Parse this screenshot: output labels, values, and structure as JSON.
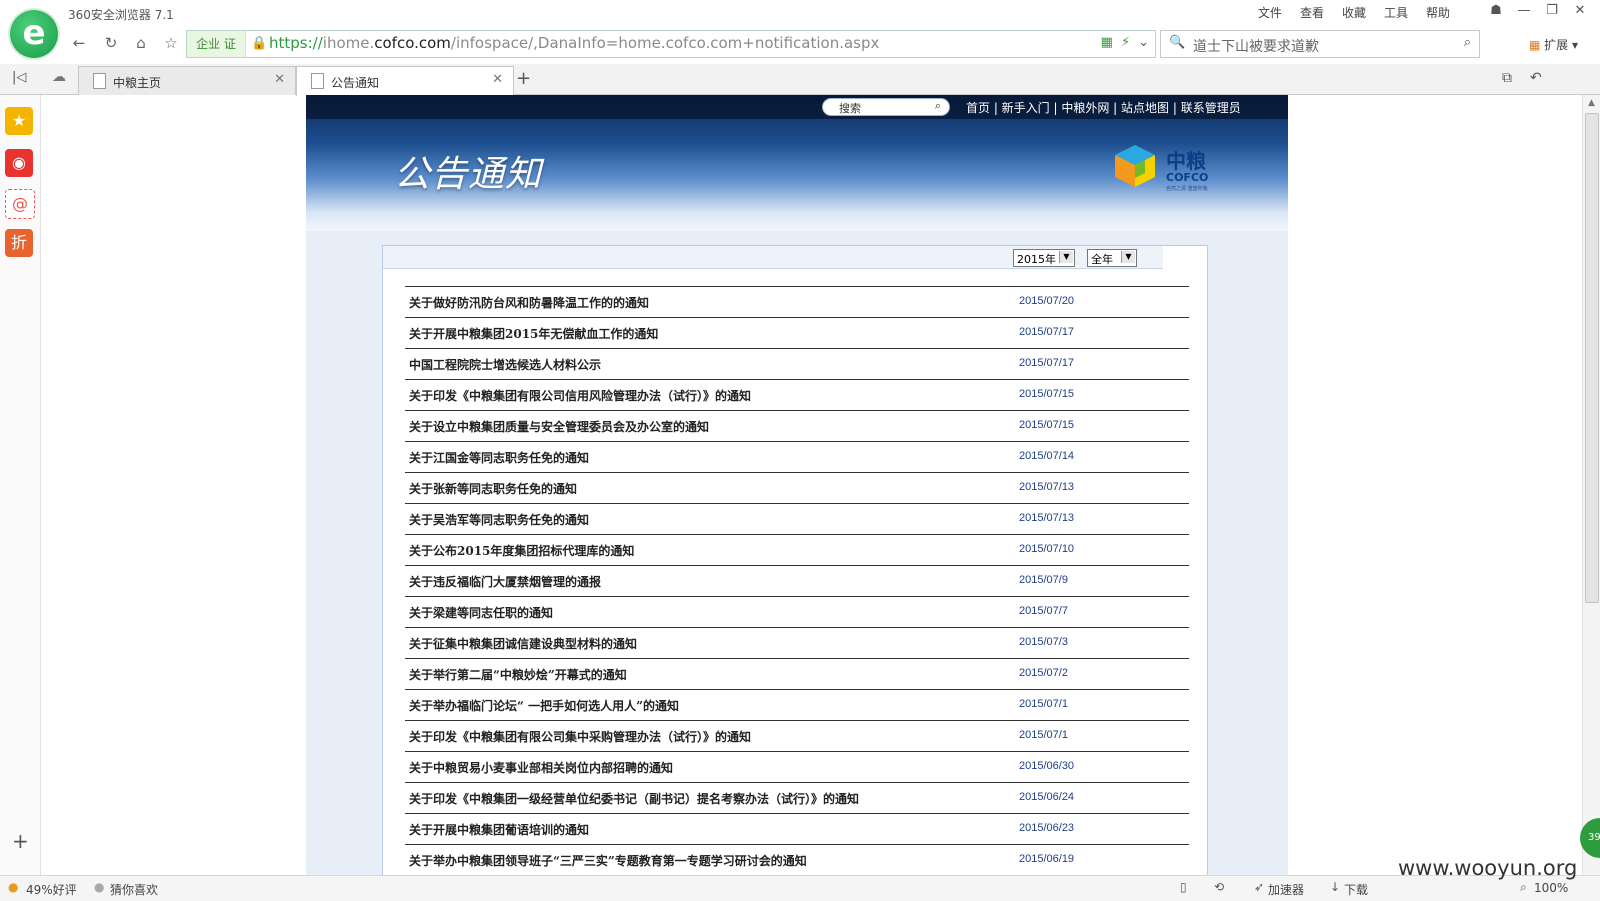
{
  "browser": {
    "app_title": "360安全浏览器 7.1",
    "menu": [
      "文件",
      "查看",
      "收藏",
      "工具",
      "帮助"
    ],
    "enterprise_badge": "企业 证",
    "url_scheme": "https://",
    "url_host_pre": "ihome.",
    "url_domain": "cofco.com",
    "url_path": "/infospace/,DanaInfo=home.cofco.com+notification.aspx",
    "search_placeholder": "道士下山被要求道歉",
    "extensions_label": "扩展",
    "tabs": [
      {
        "label": "中粮主页",
        "active": false
      },
      {
        "label": "公告通知",
        "active": true
      }
    ],
    "new_tab": "+",
    "sidebar_add": "+",
    "status": {
      "rating": "49%好评",
      "guess": "猜你喜欢",
      "accelerator": "加速器",
      "download": "下载",
      "zoom": "100%"
    }
  },
  "site": {
    "search_label": "搜索",
    "nav_links": "首页 | 新手入门 | 中粮外网 | 站点地图 | 联系管理员",
    "page_title": "公告通知",
    "brand_cn": "中粮",
    "brand_en": "COFCO",
    "brand_sub": "自然之源 重塑你我",
    "year_select": "2015年",
    "period_select": "全年"
  },
  "notices": [
    {
      "title": "关于做好防汛防台风和防暑降温工作的的通知",
      "date": "2015/07/20"
    },
    {
      "title": "关于开展中粮集团2015年无偿献血工作的通知",
      "date": "2015/07/17"
    },
    {
      "title": "中国工程院院士增选候选人材料公示",
      "date": "2015/07/17"
    },
    {
      "title": "关于印发《中粮集团有限公司信用风险管理办法（试行）》的通知",
      "date": "2015/07/15"
    },
    {
      "title": "关于设立中粮集团质量与安全管理委员会及办公室的通知",
      "date": "2015/07/15"
    },
    {
      "title": "关于江国金等同志职务任免的通知",
      "date": "2015/07/14"
    },
    {
      "title": "关于张新等同志职务任免的通知",
      "date": "2015/07/13"
    },
    {
      "title": "关于吴浩军等同志职务任免的通知",
      "date": "2015/07/13"
    },
    {
      "title": "关于公布2015年度集团招标代理库的通知",
      "date": "2015/07/10"
    },
    {
      "title": "关于违反福临门大厦禁烟管理的通报",
      "date": "2015/07/9"
    },
    {
      "title": "关于梁建等同志任职的通知",
      "date": "2015/07/7"
    },
    {
      "title": "关于征集中粮集团诚信建设典型材料的通知",
      "date": "2015/07/3"
    },
    {
      "title": "关于举行第二届“中粮妙烩”开幕式的通知",
      "date": "2015/07/2"
    },
    {
      "title": "关于举办福临门论坛“ 一把手如何选人用人”的通知",
      "date": "2015/07/1"
    },
    {
      "title": "关于印发《中粮集团有限公司集中采购管理办法（试行）》的通知",
      "date": "2015/07/1"
    },
    {
      "title": "关于中粮贸易小麦事业部相关岗位内部招聘的通知",
      "date": "2015/06/30"
    },
    {
      "title": "关于印发《中粮集团一级经营单位纪委书记（副书记）提名考察办法（试行）》的通知",
      "date": "2015/06/24"
    },
    {
      "title": "关于开展中粮集团葡语培训的通知",
      "date": "2015/06/23"
    },
    {
      "title": "关于举办中粮集团领导班子“三严三实”专题教育第一专题学习研讨会的通知",
      "date": "2015/06/19"
    }
  ],
  "overlay": {
    "watermark": "www.wooyun.org",
    "float_badge": "39"
  },
  "colors": {
    "accent_green": "#2d9a41",
    "banner_dark": "#0f2a58",
    "date_blue": "#1f3e87"
  }
}
